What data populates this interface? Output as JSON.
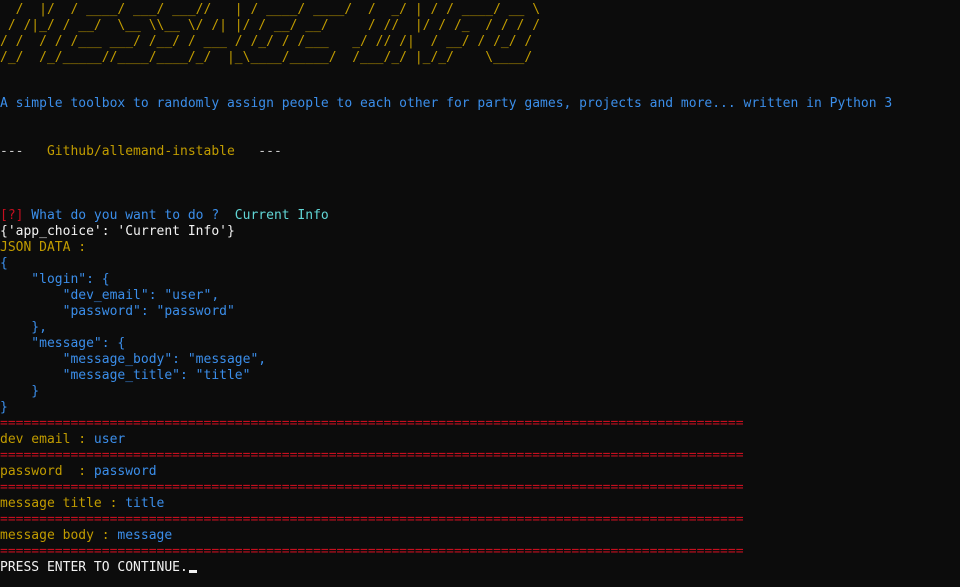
{
  "banner": [
    "  /  |/  / ____/ ___/ ___//   | / ____/ ____/  /  _/ | / / ____/ __ \\",
    " / /|_/ / __/  \\__ \\\\__ \\/ /| |/ / __/ __/     / //  |/ / /_  / / / /",
    "/ /  / / /___ ___/ /__/ / ___ / /_/ / /___   _/ // /|  / __/ / /_/ /",
    "/_/  /_/_____//____/____/_/  |_\\____/_____/  /___/_/ |_/_/    \\____/"
  ],
  "description": "A simple toolbox to randomly assign people to each other for party games, projects and more... written in Python 3",
  "github": {
    "prefix": "---   ",
    "link": "Github/allemand-instable",
    "suffix": "   ---"
  },
  "prompt": {
    "marker": "[?]",
    "question": " What do you want to do ? ",
    "answer": " Current Info"
  },
  "choice_dict": "{'app_choice': 'Current Info'}",
  "json_header": "JSON DATA :",
  "json_lines": [
    "{",
    "    \"login\": {",
    "        \"dev_email\": \"user\",",
    "        \"password\": \"password\"",
    "    },",
    "    \"message\": {",
    "        \"message_body\": \"message\",",
    "        \"message_title\": \"title\"",
    "    }",
    "}"
  ],
  "separator": "===============================================================================================",
  "fields": [
    {
      "label": "dev email : ",
      "value": "user"
    },
    {
      "label": "password  : ",
      "value": "password"
    },
    {
      "label": "message title : ",
      "value": "title"
    },
    {
      "label": "message body : ",
      "value": "message"
    }
  ],
  "continue_prompt": "PRESS ENTER TO CONTINUE."
}
